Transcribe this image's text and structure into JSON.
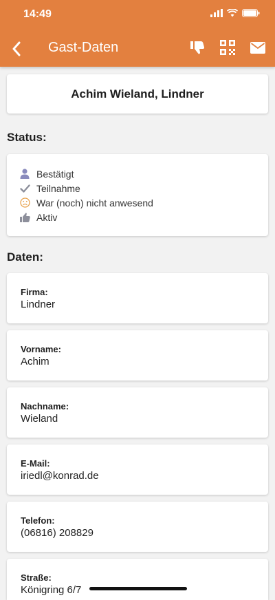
{
  "status_bar": {
    "time": "14:49"
  },
  "appbar": {
    "title": "Gast-Daten"
  },
  "guest": {
    "name": "Achim Wieland, Lindner"
  },
  "status_section": {
    "title": "Status:",
    "items": [
      {
        "label": "Bestätigt",
        "icon": "person-icon"
      },
      {
        "label": "Teilnahme",
        "icon": "checkmark-icon"
      },
      {
        "label": "War (noch) nicht anwesend",
        "icon": "sad-face-icon"
      },
      {
        "label": "Aktiv",
        "icon": "thumbs-up-icon"
      }
    ]
  },
  "data_section": {
    "title": "Daten:",
    "fields": [
      {
        "label": "Firma:",
        "value": "Lindner"
      },
      {
        "label": "Vorname:",
        "value": "Achim"
      },
      {
        "label": "Nachname:",
        "value": "Wieland"
      },
      {
        "label": "E-Mail:",
        "value": "iriedl@konrad.de"
      },
      {
        "label": "Telefon:",
        "value": "(06816) 208829"
      },
      {
        "label": "Straße:",
        "value": "Königring 6/7"
      }
    ]
  },
  "colors": {
    "accent": "#e3803f",
    "background": "#f2f2f2"
  }
}
